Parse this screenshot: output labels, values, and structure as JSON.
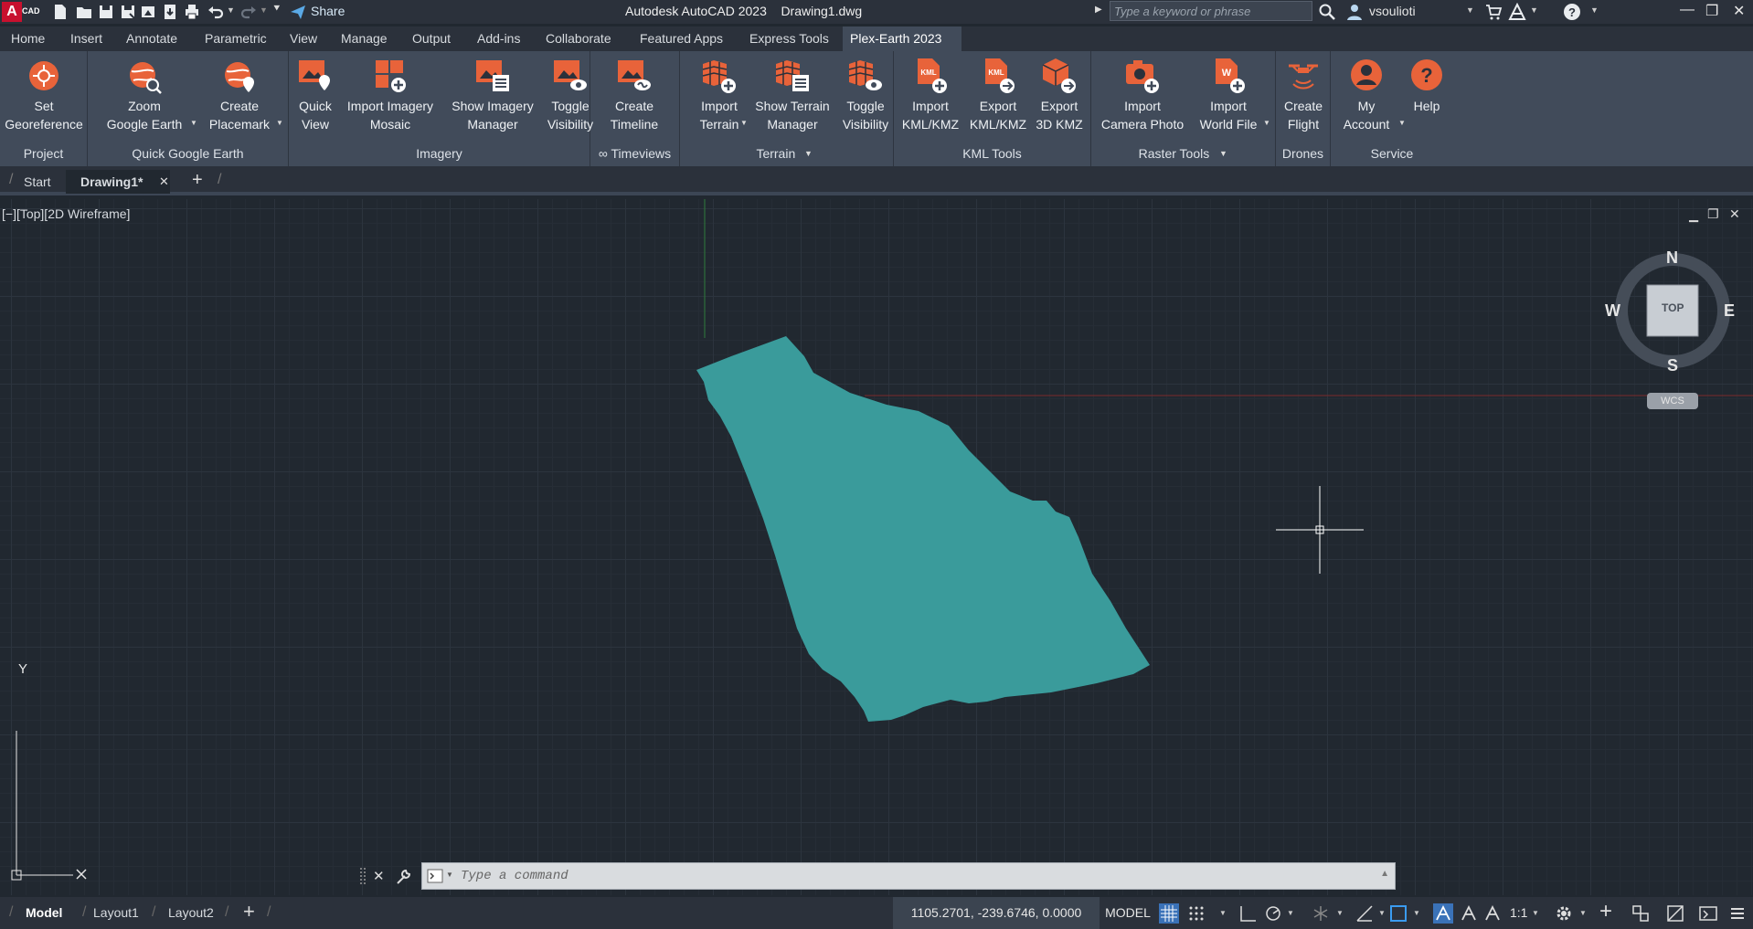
{
  "app": {
    "logo_letter": "A",
    "logo_sub": "CAD",
    "title": "Autodesk AutoCAD 2023    Drawing1.dwg",
    "share_label": "Share",
    "search_placeholder": "Type a keyword or phrase",
    "username": "vsoulioti"
  },
  "ribbon_tabs": [
    "Home",
    "Insert",
    "Annotate",
    "Parametric",
    "View",
    "Manage",
    "Output",
    "Add-ins",
    "Collaborate",
    "Featured Apps",
    "Express Tools",
    "Plex-Earth 2023"
  ],
  "active_tab": "Plex-Earth 2023",
  "panels": {
    "project": {
      "title": "Project",
      "buttons": [
        {
          "line1": "Set",
          "line2": "Georeference"
        }
      ]
    },
    "quick_google_earth": {
      "title": "Quick Google Earth",
      "buttons": [
        {
          "line1": "Zoom",
          "line2": "Google Earth"
        },
        {
          "line1": "Create",
          "line2": "Placemark"
        }
      ]
    },
    "imagery": {
      "title": "Imagery",
      "buttons": [
        {
          "line1": "Quick",
          "line2": "View"
        },
        {
          "line1": "Import Imagery",
          "line2": "Mosaic"
        },
        {
          "line1": "Show Imagery",
          "line2": "Manager"
        },
        {
          "line1": "Toggle",
          "line2": "Visibility"
        }
      ]
    },
    "timeviews": {
      "title": "∞ Timeviews",
      "buttons": [
        {
          "line1": "Create",
          "line2": "Timeline"
        }
      ]
    },
    "terrain": {
      "title": "Terrain",
      "buttons": [
        {
          "line1": "Import",
          "line2": "Terrain"
        },
        {
          "line1": "Show Terrain",
          "line2": "Manager"
        },
        {
          "line1": "Toggle",
          "line2": "Visibility"
        }
      ]
    },
    "kml_tools": {
      "title": "KML Tools",
      "buttons": [
        {
          "line1": "Import",
          "line2": "KML/KMZ"
        },
        {
          "line1": "Export",
          "line2": "KML/KMZ"
        },
        {
          "line1": "Export",
          "line2": "3D KMZ"
        }
      ]
    },
    "raster_tools": {
      "title": "Raster Tools",
      "buttons": [
        {
          "line1": "Import",
          "line2": "Camera Photo"
        },
        {
          "line1": "Import",
          "line2": "World File"
        }
      ]
    },
    "drones": {
      "title": "Drones",
      "buttons": [
        {
          "line1": "Create",
          "line2": "Flight"
        }
      ]
    },
    "service": {
      "title": "Service",
      "buttons": [
        {
          "line1": "My",
          "line2": "Account"
        },
        {
          "line1": "Help",
          "line2": ""
        }
      ]
    }
  },
  "doc_tabs": {
    "start": "Start",
    "drawing": "Drawing1*"
  },
  "viewport": {
    "label": "[−][Top][2D Wireframe]",
    "viewcube_face": "TOP",
    "compass": {
      "n": "N",
      "s": "S",
      "e": "E",
      "w": "W"
    },
    "wcs": "WCS",
    "ucs_y": "Y",
    "region_color": "#3a9b9b"
  },
  "command": {
    "placeholder": "Type a command"
  },
  "status": {
    "layouts": [
      "Model",
      "Layout1",
      "Layout2"
    ],
    "coords": "1105.2701, -239.6746, 0.0000",
    "model": "MODEL",
    "scale": "1:1"
  },
  "colors": {
    "accent": "#e8633a",
    "ribbon_bg": "#414b5a",
    "canvas_bg": "#212830"
  }
}
